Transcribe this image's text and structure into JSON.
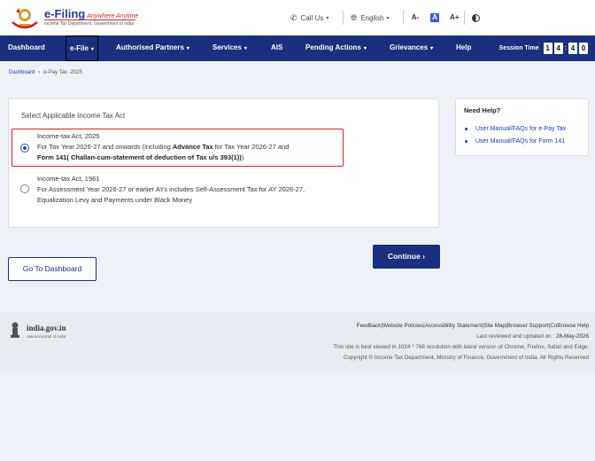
{
  "header": {
    "logo_title": "e-Filing",
    "logo_tagline": "Anywhere Anytime",
    "logo_subtitle": "Income Tax Department, Government of India",
    "call_us": "Call Us",
    "language": "English",
    "font_decrease": "A-",
    "font_normal": "A",
    "font_increase": "A+"
  },
  "nav": {
    "items": [
      {
        "label": "Dashboard",
        "has_caret": false
      },
      {
        "label": "e-File",
        "has_caret": true
      },
      {
        "label": "Authorised Partners",
        "has_caret": true
      },
      {
        "label": "Services",
        "has_caret": true
      },
      {
        "label": "AIS",
        "has_caret": false
      },
      {
        "label": "Pending Actions",
        "has_caret": true
      },
      {
        "label": "Grievances",
        "has_caret": true
      },
      {
        "label": "Help",
        "has_caret": false
      }
    ],
    "session_label": "Session Time",
    "session_digits": [
      "1",
      "4",
      "4",
      "0"
    ]
  },
  "breadcrumb": {
    "root": "Dashboard",
    "separator": "›",
    "current": "e-Pay Tax -2025"
  },
  "act_card": {
    "title": "Select Applicable Income Tax Act",
    "option1": {
      "heading": "Income-tax Act, 2025",
      "line1_a": "For Tax Year 2026-27 and onwards (including ",
      "line1_b": "Advance Tax",
      "line1_c": " for Tax Year 2026-27 and",
      "line2_a": "Form 141",
      "line2_b": "( Challan-cum-statement of deduction of Tax u/s 393(1))",
      "line2_c": ")",
      "selected": true
    },
    "option2": {
      "heading": "Income-tax Act, 1961",
      "line1": "For Assessment Year 2026-27 or earlier AYs includes Self-Assessment Tax for AY 2026-27,",
      "line2": "Equalization Levy and Payments under Black Money",
      "selected": false
    }
  },
  "help": {
    "title": "Need Help?",
    "items": [
      "User Manual/FAQs for e-Pay Tax",
      "User Manual/FAQs for Form 141"
    ]
  },
  "buttons": {
    "dashboard": "Go To Dashboard",
    "continue": "Continue",
    "continue_arrow": "›"
  },
  "footer": {
    "site": "india.gov.in",
    "portal": "national portal of india",
    "links": [
      "Feedback",
      "Website Policies",
      "Accessibility Statement",
      "Site Map",
      "Browser Support",
      "CoBrowse Help"
    ],
    "link_sep": "|",
    "last_reviewed_label": "Last reviewed and updated on : ",
    "last_reviewed_date": "28-May-2026",
    "browser_note": "This site is best viewed in 1024 * 768 resolution with latest version of Chrome, Firefox, Safari and Edge.",
    "copyright": "Copyright © Income Tax Department, Ministry of Finance, Government of India. All Rights Reserved"
  },
  "colors": {
    "nav_bg": "#1b2f7e",
    "accent_blue": "#2d4db6",
    "highlight_red": "#d2232a",
    "page_bg": "#eef1f8"
  }
}
